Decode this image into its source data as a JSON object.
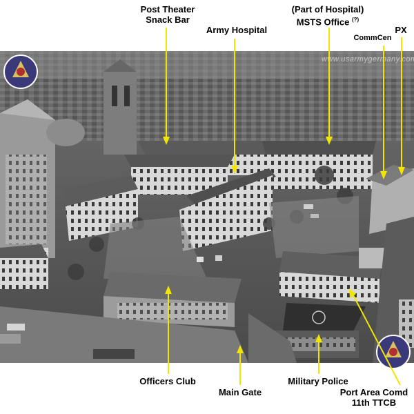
{
  "labels": {
    "post_theater": "Post Theater",
    "snack_bar": "Snack Bar",
    "army_hospital": "Army Hospital",
    "part_of_hospital": "(Part of Hospital)",
    "msts_office": "MSTS Office",
    "msts_note": "(?)",
    "commcen": "CommCen",
    "px": "PX",
    "officers_club": "Officers Club",
    "main_gate": "Main Gate",
    "military_police": "Military Police",
    "port_area_comd": "Port Area Comd",
    "ttcb": "11th TTCB"
  },
  "watermark": {
    "text": "www.usarmygermany.com"
  },
  "colors": {
    "arrow": "#f2e600",
    "label_text": "#000000",
    "photo_base": "#5a5a5a"
  },
  "icons": {
    "logo_top_left": "usareur-emblem-icon",
    "logo_bottom_right": "usareur-emblem-icon"
  }
}
